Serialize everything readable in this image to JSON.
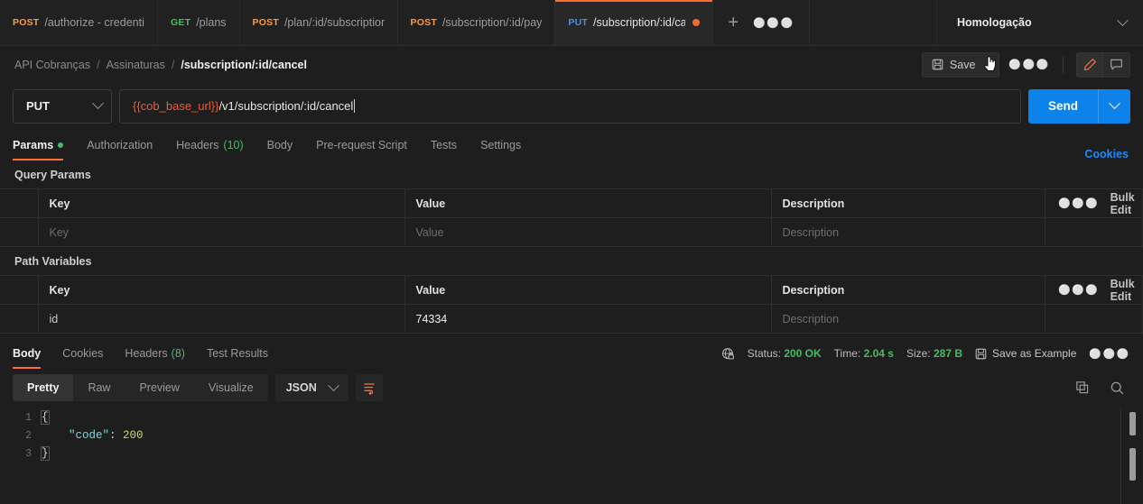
{
  "tabs": [
    {
      "verb": "POST",
      "verb_class": "verb-post",
      "name": "/authorize - credentials",
      "active": false,
      "dirty": false
    },
    {
      "verb": "GET",
      "verb_class": "verb-get",
      "name": "/plans",
      "active": false,
      "dirty": false
    },
    {
      "verb": "POST",
      "verb_class": "verb-post",
      "name": "/plan/:id/subscription",
      "active": false,
      "dirty": false
    },
    {
      "verb": "POST",
      "verb_class": "verb-post",
      "name": "/subscription/:id/pay",
      "active": false,
      "dirty": false
    },
    {
      "verb": "PUT",
      "verb_class": "verb-put",
      "name": "/subscription/:id/cance",
      "active": true,
      "dirty": true
    }
  ],
  "tabbar": {
    "new_tab_icon": "plus-icon",
    "more_icon": "ellipsis-icon",
    "environment": "Homologação"
  },
  "breadcrumb": {
    "items": [
      "API Cobranças",
      "Assinaturas"
    ],
    "current": "/subscription/:id/cancel",
    "separator": "/"
  },
  "actions": {
    "save_label": "Save",
    "save_icon": "floppy-disk-icon",
    "save_caret_icon": "chevron-down-icon",
    "more_icon": "ellipsis-icon",
    "edit_icon": "pencil-icon",
    "comment_icon": "comment-icon"
  },
  "request": {
    "method": "PUT",
    "method_caret_icon": "chevron-down-icon",
    "url_variable": "{{cob_base_url}}",
    "url_rest": "/v1/subscription/:id/cancel",
    "send_label": "Send",
    "send_caret_icon": "chevron-down-icon"
  },
  "request_tabs": [
    {
      "label": "Params",
      "active": true,
      "dot": true,
      "count": ""
    },
    {
      "label": "Authorization",
      "active": false,
      "dot": false,
      "count": ""
    },
    {
      "label": "Headers",
      "active": false,
      "dot": false,
      "count": "(10)"
    },
    {
      "label": "Body",
      "active": false,
      "dot": false,
      "count": ""
    },
    {
      "label": "Pre-request Script",
      "active": false,
      "dot": false,
      "count": ""
    },
    {
      "label": "Tests",
      "active": false,
      "dot": false,
      "count": ""
    },
    {
      "label": "Settings",
      "active": false,
      "dot": false,
      "count": ""
    }
  ],
  "cookies_link": "Cookies",
  "query_params": {
    "title": "Query Params",
    "headers": [
      "Key",
      "Value",
      "Description"
    ],
    "bulk_edit": "Bulk Edit",
    "more_icon": "ellipsis-icon",
    "rows": [
      {
        "key": "Key",
        "key_placeholder": true,
        "value": "Value",
        "value_placeholder": true,
        "description": "Description",
        "description_placeholder": true
      }
    ]
  },
  "path_variables": {
    "title": "Path Variables",
    "headers": [
      "Key",
      "Value",
      "Description"
    ],
    "bulk_edit": "Bulk Edit",
    "more_icon": "ellipsis-icon",
    "rows": [
      {
        "key": "id",
        "key_placeholder": false,
        "value": "74334",
        "value_placeholder": false,
        "description": "Description",
        "description_placeholder": true
      }
    ]
  },
  "response_tabs": [
    {
      "label": "Body",
      "active": true,
      "count": ""
    },
    {
      "label": "Cookies",
      "active": false,
      "count": ""
    },
    {
      "label": "Headers",
      "active": false,
      "count": "(8)"
    },
    {
      "label": "Test Results",
      "active": false,
      "count": ""
    }
  ],
  "response_meta": {
    "network_icon": "globe-lock-icon",
    "status_label": "Status:",
    "status_value": "200 OK",
    "time_label": "Time:",
    "time_value": "2.04 s",
    "size_label": "Size:",
    "size_value": "287 B",
    "save_example_icon": "floppy-disk-icon",
    "save_example_label": "Save as Example",
    "more_icon": "ellipsis-icon"
  },
  "response_view": {
    "segments": [
      {
        "label": "Pretty",
        "active": true
      },
      {
        "label": "Raw",
        "active": false
      },
      {
        "label": "Preview",
        "active": false
      },
      {
        "label": "Visualize",
        "active": false
      }
    ],
    "format": "JSON",
    "format_caret_icon": "chevron-down-icon",
    "wrap_icon": "wrap-text-icon",
    "copy_icon": "copy-icon",
    "search_icon": "search-icon"
  },
  "response_body": {
    "language": "json",
    "lines": [
      {
        "number": "1",
        "tokens": [
          {
            "t": "{",
            "c": "k-brace"
          }
        ]
      },
      {
        "number": "2",
        "tokens": [
          {
            "t": "    ",
            "c": "k-punc"
          },
          {
            "t": "\"code\"",
            "c": "k-key"
          },
          {
            "t": ": ",
            "c": "k-punc"
          },
          {
            "t": "200",
            "c": "k-num"
          }
        ]
      },
      {
        "number": "3",
        "tokens": [
          {
            "t": "}",
            "c": "k-brace"
          }
        ]
      }
    ]
  },
  "colors": {
    "accent_orange": "#ff6c37",
    "send_blue": "#0c82eb",
    "success_green": "#4aba66",
    "link_blue": "#1a8cff",
    "variable_red": "#f05a3c",
    "background": "#1e1e1e"
  },
  "cursor": {
    "type": "pointing-hand"
  }
}
